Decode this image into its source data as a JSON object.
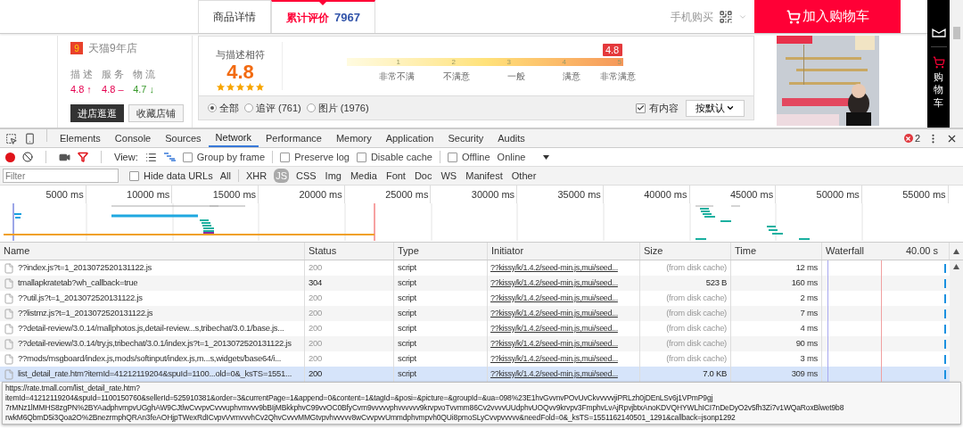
{
  "page": {
    "tabs": [
      {
        "label": "商品详情",
        "selected": false
      },
      {
        "label": "累计评价",
        "count": "7967",
        "selected": true
      }
    ],
    "mobile_buy": "手机购买",
    "add_to_cart": "加入购物车",
    "store": {
      "badge": "9",
      "name": "天猫9年店",
      "scores": [
        {
          "label": "描 述",
          "value": "4.8",
          "trend": "↑",
          "color": "#e5004f"
        },
        {
          "label": "服 务",
          "value": "4.8",
          "trend": "–",
          "color": "#e5004f"
        },
        {
          "label": "物 流",
          "value": "4.7",
          "trend": "↓",
          "color": "#3b9b2e"
        }
      ],
      "buttons": [
        {
          "label": "进店逛逛",
          "kind": "primary"
        },
        {
          "label": "收藏店铺",
          "kind": "secondary"
        }
      ]
    },
    "rating": {
      "title": "与描述相符",
      "score": "4.8",
      "stars": 5,
      "marker": "4.8",
      "level": 0.96,
      "scale": [
        {
          "number": "1",
          "label": "非常不满"
        },
        {
          "number": "2",
          "label": "不满意"
        },
        {
          "number": "3",
          "label": "一般"
        },
        {
          "number": "4",
          "label": "满意"
        },
        {
          "number": "5",
          "label": "非常满意"
        }
      ]
    },
    "filters": [
      {
        "label": "全部",
        "selected": true
      },
      {
        "label": "追评 (761)",
        "selected": false
      },
      {
        "label": "图片 (1976)",
        "selected": false
      }
    ],
    "has_content": {
      "label": "有内容",
      "checked": true
    },
    "sort": "按默认",
    "sidebar": {
      "cart_label": "购物车"
    }
  },
  "devtools": {
    "tabs": [
      {
        "label": "Elements",
        "selected": false
      },
      {
        "label": "Console",
        "selected": false
      },
      {
        "label": "Sources",
        "selected": false
      },
      {
        "label": "Network",
        "selected": true
      },
      {
        "label": "Performance",
        "selected": false
      },
      {
        "label": "Memory",
        "selected": false
      },
      {
        "label": "Application",
        "selected": false
      },
      {
        "label": "Security",
        "selected": false
      },
      {
        "label": "Audits",
        "selected": false
      }
    ],
    "error_count": "2",
    "toolbar": {
      "recording": true,
      "view_label": "View:",
      "group_by_frame": {
        "label": "Group by frame",
        "checked": false
      },
      "preserve_log": {
        "label": "Preserve log",
        "checked": false
      },
      "disable_cache": {
        "label": "Disable cache",
        "checked": false
      },
      "offline": {
        "label": "Offline",
        "checked": false
      },
      "throttle": "Online"
    },
    "filter": {
      "placeholder": "Filter",
      "hide_data_urls": {
        "label": "Hide data URLs",
        "checked": false
      },
      "types": [
        {
          "label": "All",
          "selected": false
        },
        {
          "label": "XHR",
          "selected": false
        },
        {
          "label": "JS",
          "selected": true
        },
        {
          "label": "CSS",
          "selected": false
        },
        {
          "label": "Img",
          "selected": false
        },
        {
          "label": "Media",
          "selected": false
        },
        {
          "label": "Font",
          "selected": false
        },
        {
          "label": "Doc",
          "selected": false
        },
        {
          "label": "WS",
          "selected": false
        },
        {
          "label": "Manifest",
          "selected": false
        },
        {
          "label": "Other",
          "selected": false
        }
      ]
    },
    "timeline": {
      "ticks": [
        "5000 ms",
        "10000 ms",
        "15000 ms",
        "20000 ms",
        "25000 ms",
        "30000 ms",
        "35000 ms",
        "40000 ms",
        "45000 ms",
        "50000 ms",
        "55000 ms"
      ]
    },
    "table": {
      "columns": [
        "Name",
        "Status",
        "Type",
        "Initiator",
        "Size",
        "Time",
        "Waterfall"
      ],
      "waterfall_scale": "40.00 s",
      "rows": [
        {
          "name": "??index.js?t=1_2013072520131122.js",
          "status": "200",
          "type": "script",
          "initiator": "??kissy/k/1.4.2/seed-min.js,mui/seed...",
          "size": "(from disk cache)",
          "time": "12 ms",
          "from_cache": true,
          "selected": false
        },
        {
          "name": "tmallapkratetab?wh_callback=true",
          "status": "304",
          "type": "script",
          "initiator": "??kissy/k/1.4.2/seed-min.js,mui/seed...",
          "size": "523 B",
          "time": "160 ms",
          "from_cache": false,
          "selected": false
        },
        {
          "name": "??util.js?t=1_2013072520131122.js",
          "status": "200",
          "type": "script",
          "initiator": "??kissy/k/1.4.2/seed-min.js,mui/seed...",
          "size": "(from disk cache)",
          "time": "2 ms",
          "from_cache": true,
          "selected": false
        },
        {
          "name": "??listmz.js?t=1_2013072520131122.js",
          "status": "200",
          "type": "script",
          "initiator": "??kissy/k/1.4.2/seed-min.js,mui/seed...",
          "size": "(from disk cache)",
          "time": "7 ms",
          "from_cache": true,
          "selected": false
        },
        {
          "name": "??detail-review/3.0.14/mallphotos.js,detail-review...s,tribechat/3.0.1/base.js...",
          "status": "200",
          "type": "script",
          "initiator": "??kissy/k/1.4.2/seed-min.js,mui/seed...",
          "size": "(from disk cache)",
          "time": "4 ms",
          "from_cache": true,
          "selected": false
        },
        {
          "name": "??detail-review/3.0.14/try.js,tribechat/3.0.1/index.js?t=1_2013072520131122.js",
          "status": "200",
          "type": "script",
          "initiator": "??kissy/k/1.4.2/seed-min.js,mui/seed...",
          "size": "(from disk cache)",
          "time": "90 ms",
          "from_cache": true,
          "selected": false
        },
        {
          "name": "??mods/msgboard/index.js,mods/softinput/index.js,m...s,widgets/base64/i...",
          "status": "200",
          "type": "script",
          "initiator": "??kissy/k/1.4.2/seed-min.js,mui/seed...",
          "size": "(from disk cache)",
          "time": "3 ms",
          "from_cache": true,
          "selected": false
        },
        {
          "name": "list_detail_rate.htm?itemId=41212119204&spuId=1100...old=0&_ksTS=1551...",
          "status": "200",
          "type": "script",
          "initiator": "??kissy/k/1.4.2/seed-min.js,mui/seed...",
          "size": "7.0 KB",
          "time": "309 ms",
          "from_cache": false,
          "selected": true
        }
      ]
    },
    "tooltip": {
      "lines": [
        "https://rate.tmall.com/list_detail_rate.htm?",
        "itemId=41212119204&spuId=1100150760&sellerId=525910381&order=3&currentPage=1&append=0&content=1&tagId=&posi=&picture=&groupId=&ua=098%23E1hvGvvnvPOvUvCkvvvvvjiPRLzh0jDEnLSv6j1VPmP9gj",
        "7rMNz1lMMHS8zgPN%2BYAadphvmpvUGghAW9CJtlwCvvpvCvvvuphvmvvv9bBIjMBkkphvC99vvOC0BfyCvm9vvvvvphvvvvvv9krvpvoTvvmm86Cv2vvvvUUdphvUOQvv9krvpv3FmphvLvAjRpvjbtxAnoKDVQHYWLhICI7nDeDyO2v5fh3Zi7v1WQaRoxBlwet9b8",
        "rwkM6QbmD5i3Qoa2O%2BnezrmphQRAn3feAOHjpTWexRdICvpvVvmvvvhCv2QhvCvvvMMGtvpvhvvvvv8wCvvpvvUmmdphvmpvh0QUi8pmoSLyCvvpvvvvv&needFold=0&_ksTS=1551162140501_1291&callback=jsonp1292"
      ]
    }
  }
}
